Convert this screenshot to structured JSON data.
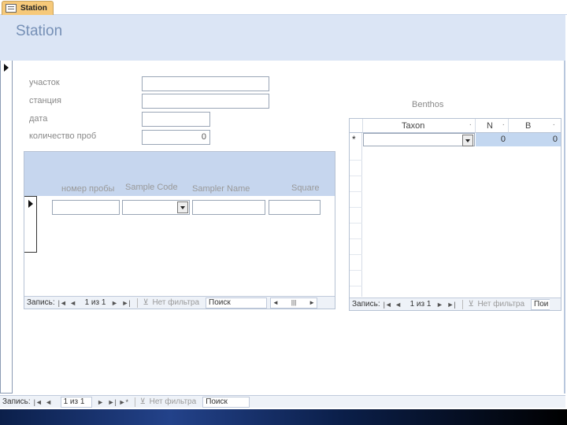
{
  "tab": {
    "label": "Station",
    "icon": "form-icon"
  },
  "form": {
    "title": "Station"
  },
  "fields": {
    "uchastok_label": "участок",
    "stantsiya_label": "станция",
    "data_label": "дата",
    "kolichestvo_label": "количество проб",
    "kolichestvo_value": "0"
  },
  "subform_samples": {
    "columns": [
      "номер пробы",
      "Sample Code",
      "Sampler Name",
      "Square"
    ],
    "nav": {
      "label": "Запись:",
      "position": "1 из 1",
      "filter": "Нет фильтра",
      "search": "Поиск"
    }
  },
  "subform_benthos": {
    "title": "Benthos",
    "columns": [
      "Taxon",
      "N",
      "B"
    ],
    "new_row": {
      "marker": "*",
      "n": "0",
      "b": "0"
    },
    "nav": {
      "label": "Запись:",
      "position": "1 из 1",
      "filter": "Нет фильтра",
      "search": "Пои"
    }
  },
  "main_nav": {
    "label": "Запись:",
    "position": "1 из 1",
    "filter": "Нет фильтра",
    "search": "Поиск"
  }
}
